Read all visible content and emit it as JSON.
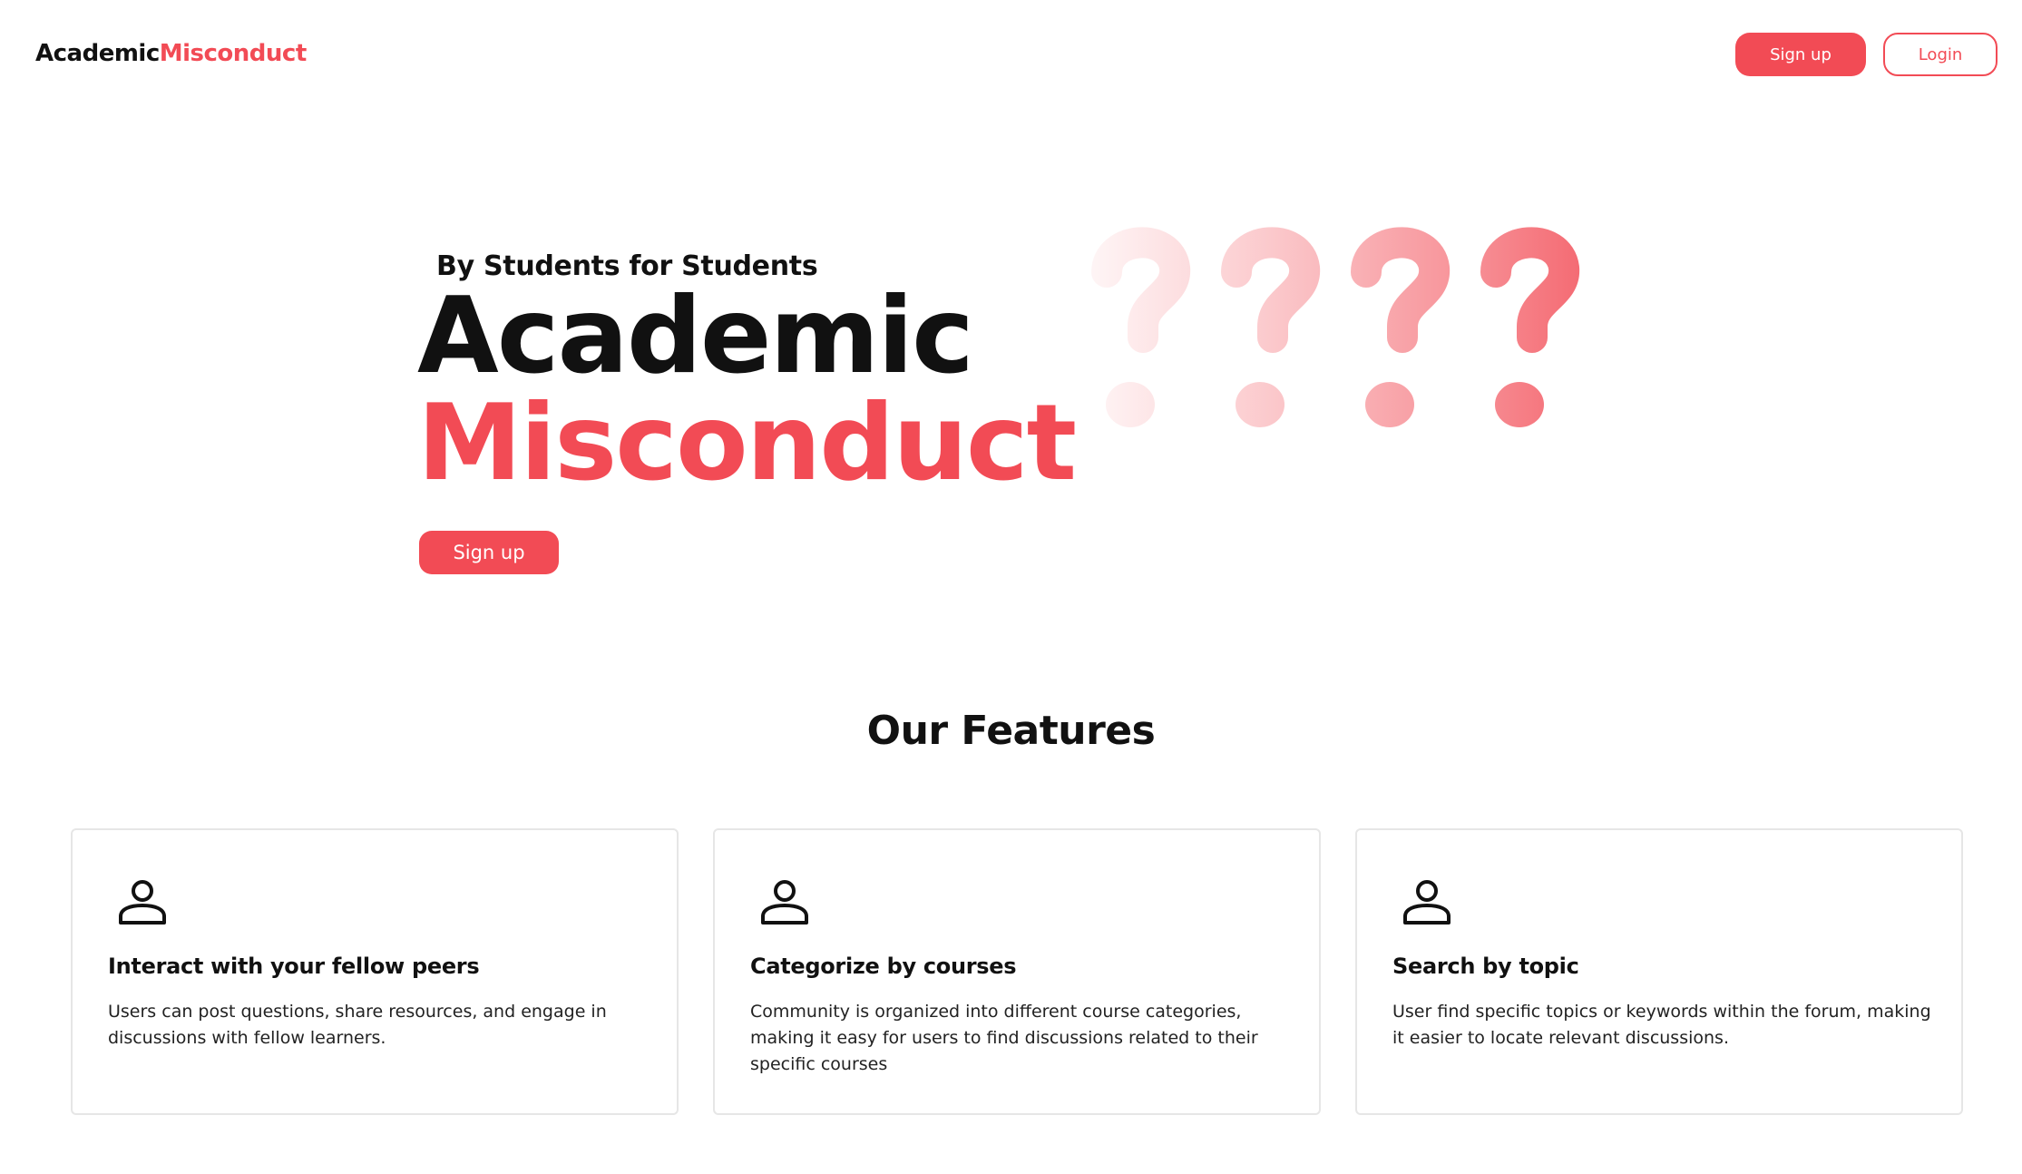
{
  "header": {
    "brand_part1": "Academic",
    "brand_part2": "Misconduct",
    "signup_label": "Sign up",
    "login_label": "Login"
  },
  "hero": {
    "tagline": "By Students for Students",
    "title_line1": "Academic",
    "title_line2": "Misconduct",
    "signup_label": "Sign up",
    "decoration_icon": "question-marks-gradient"
  },
  "features": {
    "title": "Our Features",
    "cards": [
      {
        "icon": "user-icon",
        "title": "Interact with your fellow peers",
        "description": "Users can post questions, share resources, and engage in discussions with fellow learners."
      },
      {
        "icon": "user-icon",
        "title": "Categorize by courses",
        "description": "Community is organized into different course categories, making it easy for users to find discussions related to their specific courses"
      },
      {
        "icon": "user-icon",
        "title": "Search by topic",
        "description": "User find specific topics or keywords within the forum, making it easier to locate relevant discussions."
      }
    ]
  },
  "colors": {
    "accent": "#f24b55",
    "text": "#111111",
    "card_border": "#e6e6e6"
  }
}
